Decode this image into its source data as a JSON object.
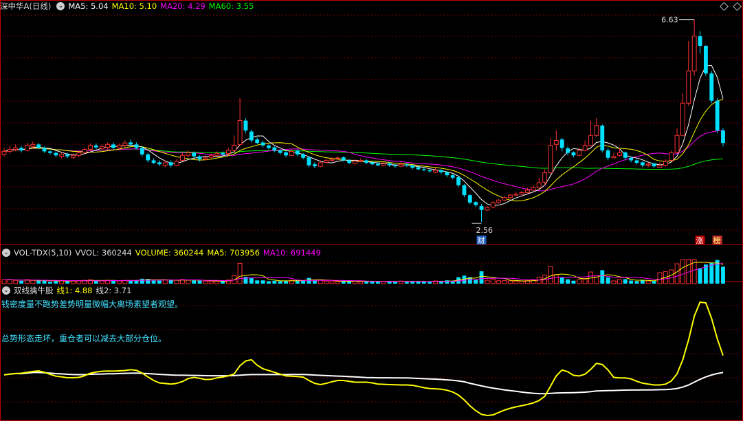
{
  "main_header": {
    "stock_name": "深中华A(日线)",
    "ma5": "MA5: 5.04",
    "ma10": "MA10: 5.10",
    "ma20": "MA20: 4.29",
    "ma60": "MA60: 3.55"
  },
  "vol_header": {
    "title": "VOL-TDX(5,10)",
    "vvol": "VVOL: 360244",
    "volume": "VOLUME: 360244",
    "ma5": "MA5: 703956",
    "ma10": "MA10: 691449"
  },
  "ind_header": {
    "title": "双线擒牛股",
    "line1": "线1: 4.88",
    "line2": "线2: 3.71"
  },
  "notes": {
    "top": "钱密度量不跑势差势明量微幅大离场素望者观望。",
    "bottom": "总势形态走坏，重仓者可以减去大部分仓位。"
  },
  "chart_data": {
    "type": "candlestick",
    "title": "深中华A(日线)",
    "high_marker": "6.63",
    "low_marker": "2.56",
    "badges": [
      "财",
      "涨",
      "榜"
    ],
    "colors": {
      "up": "#ff3232",
      "down": "#00e0ff",
      "ma5": "#ffffff",
      "ma10": "#ffff00",
      "ma20": "#ff00ff",
      "ma60": "#00ff00",
      "line1": "#ffff00",
      "line2": "#ffffff"
    },
    "close": [
      3.98,
      4.02,
      4.05,
      4.0,
      4.1,
      4.12,
      4.05,
      3.98,
      3.95,
      3.9,
      3.92,
      3.88,
      3.9,
      3.95,
      4.02,
      4.1,
      4.06,
      4.08,
      4.12,
      4.05,
      4.1,
      4.15,
      4.12,
      4.05,
      3.92,
      3.8,
      3.75,
      3.72,
      3.75,
      3.7,
      3.78,
      3.9,
      3.95,
      3.88,
      3.82,
      3.85,
      3.9,
      3.94,
      3.92,
      4.0,
      4.1,
      4.6,
      4.4,
      4.2,
      4.15,
      4.1,
      4.05,
      4.0,
      3.95,
      3.9,
      3.98,
      3.92,
      3.85,
      3.7,
      3.68,
      3.75,
      3.8,
      3.82,
      3.85,
      3.8,
      3.75,
      3.78,
      3.8,
      3.75,
      3.72,
      3.7,
      3.73,
      3.7,
      3.68,
      3.72,
      3.7,
      3.65,
      3.62,
      3.6,
      3.58,
      3.6,
      3.56,
      3.5,
      3.45,
      3.3,
      3.1,
      2.95,
      2.9,
      2.8,
      2.85,
      2.95,
      3.0,
      3.05,
      3.1,
      3.12,
      3.15,
      3.2,
      3.25,
      3.35,
      3.55,
      4.1,
      4.2,
      4.05,
      3.95,
      3.9,
      4.0,
      4.1,
      4.3,
      4.5,
      4.0,
      3.85,
      3.88,
      3.95,
      3.85,
      3.8,
      3.75,
      3.7,
      3.72,
      3.68,
      3.7,
      3.78,
      3.95,
      4.3,
      4.95,
      5.6,
      6.3,
      6.1,
      5.55,
      5.0,
      4.4,
      4.15
    ],
    "open": [
      3.92,
      3.98,
      4.02,
      4.05,
      4.0,
      4.08,
      4.12,
      4.05,
      3.98,
      3.95,
      3.88,
      3.92,
      3.86,
      3.9,
      3.96,
      4.02,
      4.1,
      4.04,
      4.06,
      4.12,
      4.05,
      4.1,
      4.16,
      4.12,
      4.05,
      3.92,
      3.8,
      3.76,
      3.7,
      3.76,
      3.7,
      3.8,
      3.9,
      3.95,
      3.88,
      3.82,
      3.86,
      3.9,
      3.95,
      3.94,
      4.0,
      4.12,
      4.6,
      4.38,
      4.22,
      4.16,
      4.1,
      4.06,
      4.0,
      3.96,
      3.9,
      4.0,
      3.92,
      3.86,
      3.72,
      3.68,
      3.76,
      3.8,
      3.84,
      3.86,
      3.8,
      3.74,
      3.78,
      3.8,
      3.76,
      3.73,
      3.7,
      3.74,
      3.7,
      3.68,
      3.72,
      3.7,
      3.66,
      3.62,
      3.6,
      3.56,
      3.6,
      3.56,
      3.5,
      3.46,
      3.3,
      3.1,
      2.96,
      2.88,
      2.8,
      2.86,
      2.95,
      3.0,
      3.05,
      3.1,
      3.12,
      3.15,
      3.2,
      3.25,
      3.36,
      3.55,
      4.12,
      4.22,
      4.04,
      3.96,
      3.9,
      4.0,
      4.1,
      4.3,
      4.5,
      4.0,
      3.85,
      3.9,
      3.96,
      3.85,
      3.8,
      3.76,
      3.7,
      3.74,
      3.66,
      3.7,
      3.8,
      3.96,
      4.3,
      4.95,
      5.6,
      6.3,
      6.1,
      5.55,
      5.0,
      4.4
    ],
    "high": [
      4.05,
      4.1,
      4.12,
      4.08,
      4.15,
      4.18,
      4.15,
      4.08,
      4.0,
      3.98,
      3.96,
      3.95,
      3.94,
      3.98,
      4.06,
      4.14,
      4.14,
      4.12,
      4.16,
      4.16,
      4.14,
      4.2,
      4.22,
      4.16,
      4.08,
      3.95,
      3.84,
      3.8,
      3.8,
      3.8,
      3.82,
      3.95,
      4.0,
      3.98,
      3.9,
      3.9,
      3.94,
      3.98,
      3.98,
      4.05,
      4.3,
      5.05,
      4.65,
      4.42,
      4.26,
      4.2,
      4.12,
      4.08,
      4.02,
      3.98,
      4.02,
      4.02,
      3.95,
      3.88,
      3.76,
      3.8,
      3.84,
      3.86,
      3.88,
      3.88,
      3.82,
      3.82,
      3.84,
      3.82,
      3.78,
      3.76,
      3.77,
      3.76,
      3.72,
      3.76,
      3.74,
      3.72,
      3.68,
      3.65,
      3.62,
      3.64,
      3.62,
      3.58,
      3.52,
      3.48,
      3.32,
      3.12,
      2.98,
      2.92,
      2.88,
      2.98,
      3.02,
      3.08,
      3.12,
      3.16,
      3.18,
      3.24,
      3.3,
      3.45,
      3.62,
      4.25,
      4.4,
      4.25,
      4.08,
      3.98,
      4.05,
      4.2,
      4.6,
      4.65,
      4.52,
      4.05,
      3.95,
      4.05,
      3.98,
      3.88,
      3.82,
      3.78,
      3.76,
      3.74,
      3.76,
      3.82,
      4.0,
      4.45,
      5.15,
      6.2,
      6.63,
      6.4,
      6.12,
      5.6,
      5.05,
      4.45
    ],
    "low": [
      3.88,
      3.94,
      3.98,
      3.96,
      3.98,
      4.04,
      4.02,
      3.95,
      3.92,
      3.86,
      3.84,
      3.84,
      3.82,
      3.86,
      3.92,
      3.98,
      4.02,
      4.0,
      4.02,
      4.02,
      4.02,
      4.06,
      4.08,
      4.02,
      3.88,
      3.76,
      3.72,
      3.68,
      3.66,
      3.66,
      3.68,
      3.78,
      3.86,
      3.85,
      3.78,
      3.8,
      3.84,
      3.88,
      3.88,
      3.9,
      3.96,
      4.08,
      4.34,
      4.16,
      4.12,
      4.06,
      4.02,
      3.96,
      3.92,
      3.86,
      3.88,
      3.88,
      3.82,
      3.66,
      3.64,
      3.66,
      3.74,
      3.78,
      3.8,
      3.78,
      3.72,
      3.72,
      3.76,
      3.72,
      3.7,
      3.68,
      3.68,
      3.67,
      3.65,
      3.66,
      3.67,
      3.62,
      3.6,
      3.58,
      3.55,
      3.54,
      3.52,
      3.46,
      3.42,
      3.26,
      3.06,
      2.92,
      2.86,
      2.56,
      2.78,
      2.84,
      2.93,
      2.98,
      3.03,
      3.08,
      3.1,
      3.14,
      3.18,
      3.22,
      3.3,
      3.52,
      4.0,
      3.98,
      3.9,
      3.86,
      3.88,
      3.98,
      4.08,
      4.28,
      3.96,
      3.8,
      3.84,
      3.88,
      3.8,
      3.76,
      3.72,
      3.66,
      3.66,
      3.64,
      3.66,
      3.68,
      3.78,
      3.94,
      4.28,
      4.9,
      5.5,
      5.95,
      5.5,
      4.95,
      4.35,
      4.08
    ]
  }
}
